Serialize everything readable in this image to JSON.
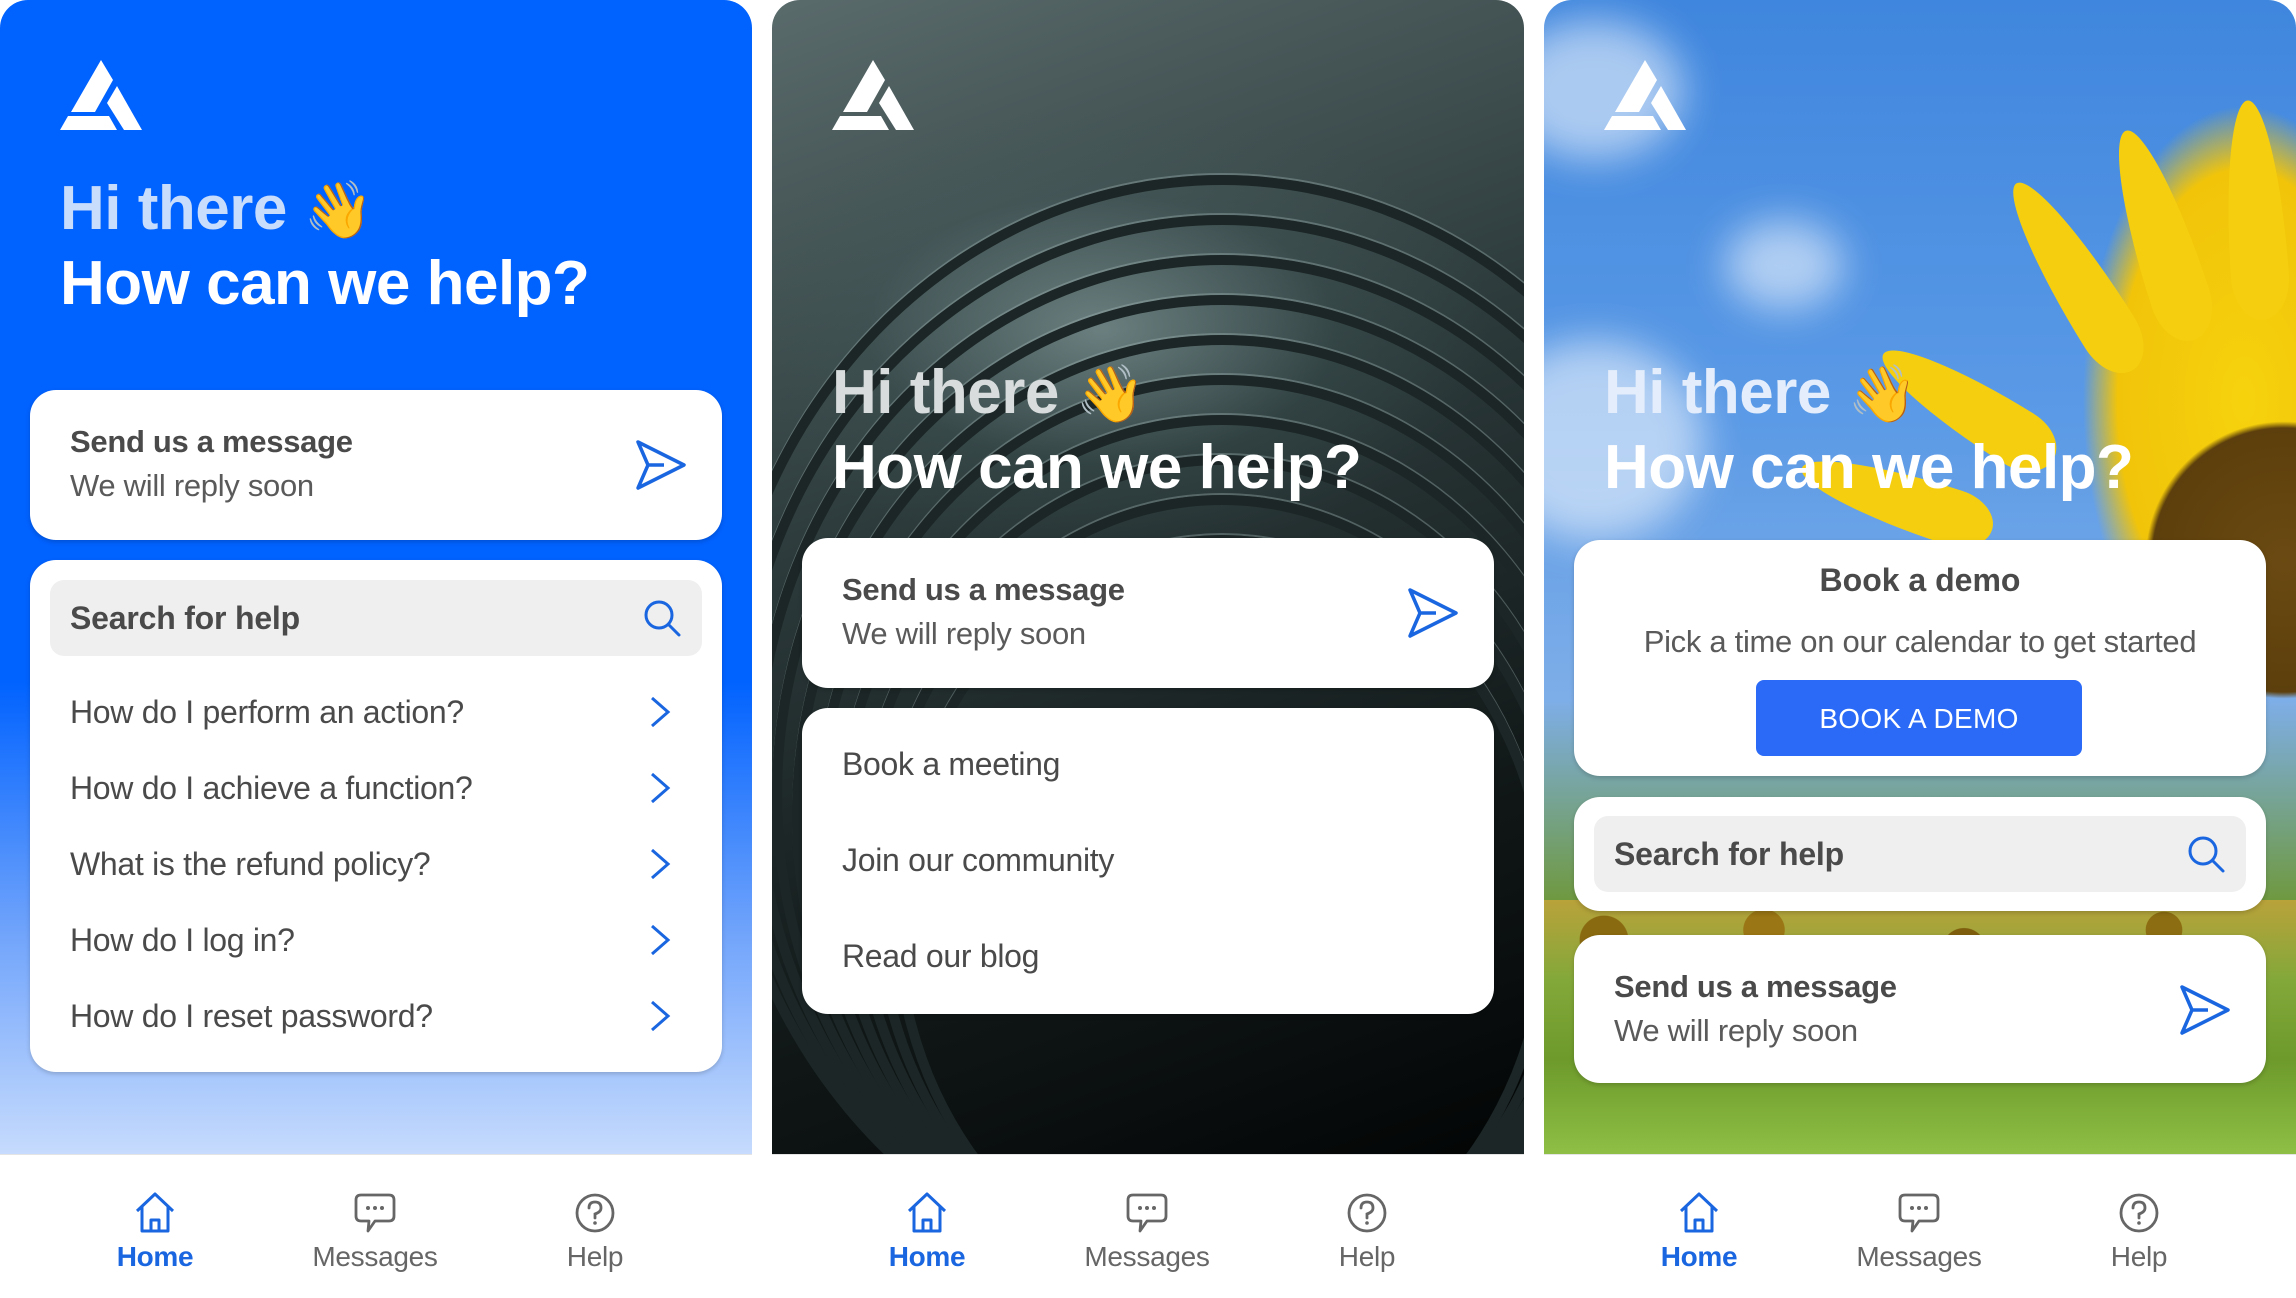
{
  "colors": {
    "brand_blue": "#0062ff",
    "accent_blue": "#1a66e0",
    "button_blue": "#2a6af6",
    "text_dark": "#4a4a4a",
    "nav_inactive": "#666666"
  },
  "panels": [
    {
      "theme": "blue",
      "logo": "triangle-logo-icon",
      "greeting": {
        "line1": "Hi there",
        "emoji": "👋",
        "line2": "How can we help?"
      },
      "message_card": {
        "title": "Send us a message",
        "subtitle": "We will reply soon",
        "icon": "send-icon"
      },
      "search": {
        "placeholder": "Search for help",
        "icon": "search-icon"
      },
      "faq": [
        {
          "label": "How do I perform an action?"
        },
        {
          "label": "How do I achieve a function?"
        },
        {
          "label": "What is the refund policy?"
        },
        {
          "label": "How do I log in?"
        },
        {
          "label": "How do I reset password?"
        }
      ],
      "nav": [
        {
          "label": "Home",
          "icon": "home-icon",
          "active": true
        },
        {
          "label": "Messages",
          "icon": "chat-bubble-icon",
          "active": false
        },
        {
          "label": "Help",
          "icon": "help-circle-icon",
          "active": false
        }
      ]
    },
    {
      "theme": "dark-waves",
      "logo": "triangle-logo-icon",
      "greeting": {
        "line1": "Hi there",
        "emoji": "👋",
        "line2": "How can we help?"
      },
      "message_card": {
        "title": "Send us a message",
        "subtitle": "We will reply soon",
        "icon": "send-icon"
      },
      "links": [
        {
          "label": "Book a meeting"
        },
        {
          "label": "Join our community"
        },
        {
          "label": "Read our blog"
        }
      ],
      "nav": [
        {
          "label": "Home",
          "icon": "home-icon",
          "active": true
        },
        {
          "label": "Messages",
          "icon": "chat-bubble-icon",
          "active": false
        },
        {
          "label": "Help",
          "icon": "help-circle-icon",
          "active": false
        }
      ]
    },
    {
      "theme": "sunflower",
      "logo": "triangle-logo-icon",
      "greeting": {
        "line1": "Hi there",
        "emoji": "👋",
        "line2": "How can we help?"
      },
      "demo_card": {
        "title": "Book a demo",
        "subtitle": "Pick a time on our calendar to get started",
        "button_label": "BOOK A DEMO"
      },
      "search": {
        "placeholder": "Search for help",
        "icon": "search-icon"
      },
      "message_card": {
        "title": "Send us a message",
        "subtitle": "We will reply soon",
        "icon": "send-icon"
      },
      "nav": [
        {
          "label": "Home",
          "icon": "home-icon",
          "active": true
        },
        {
          "label": "Messages",
          "icon": "chat-bubble-icon",
          "active": false
        },
        {
          "label": "Help",
          "icon": "help-circle-icon",
          "active": false
        }
      ]
    }
  ]
}
